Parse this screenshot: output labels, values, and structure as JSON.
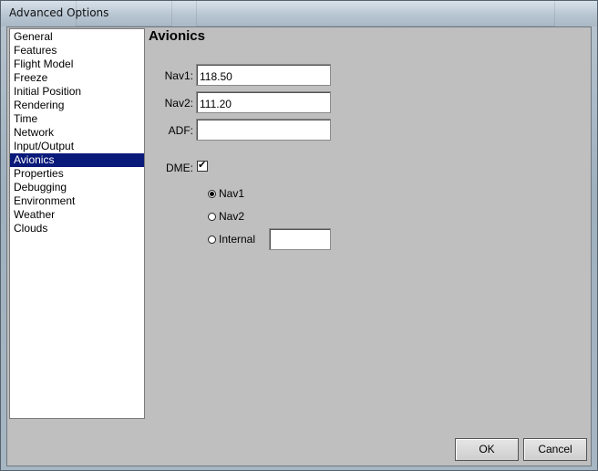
{
  "window": {
    "title": "Advanced Options"
  },
  "sidebar": {
    "items": [
      {
        "label": "General",
        "selected": false
      },
      {
        "label": "Features",
        "selected": false
      },
      {
        "label": "Flight Model",
        "selected": false
      },
      {
        "label": "Freeze",
        "selected": false
      },
      {
        "label": "Initial Position",
        "selected": false
      },
      {
        "label": "Rendering",
        "selected": false
      },
      {
        "label": "Time",
        "selected": false
      },
      {
        "label": "Network",
        "selected": false
      },
      {
        "label": "Input/Output",
        "selected": false
      },
      {
        "label": "Avionics",
        "selected": true
      },
      {
        "label": "Properties",
        "selected": false
      },
      {
        "label": "Debugging",
        "selected": false
      },
      {
        "label": "Environment",
        "selected": false
      },
      {
        "label": "Weather",
        "selected": false
      },
      {
        "label": "Clouds",
        "selected": false
      }
    ]
  },
  "panel": {
    "title": "Avionics",
    "nav1": {
      "label": "Nav1:",
      "value": "118.50"
    },
    "nav2": {
      "label": "Nav2:",
      "value": "111.20"
    },
    "adf": {
      "label": "ADF:",
      "value": ""
    },
    "dme": {
      "label": "DME:",
      "checked": true,
      "options": [
        {
          "label": "Nav1",
          "selected": true
        },
        {
          "label": "Nav2",
          "selected": false
        },
        {
          "label": "Internal",
          "selected": false
        }
      ],
      "internal_value": ""
    }
  },
  "buttons": {
    "ok": "OK",
    "cancel": "Cancel"
  }
}
